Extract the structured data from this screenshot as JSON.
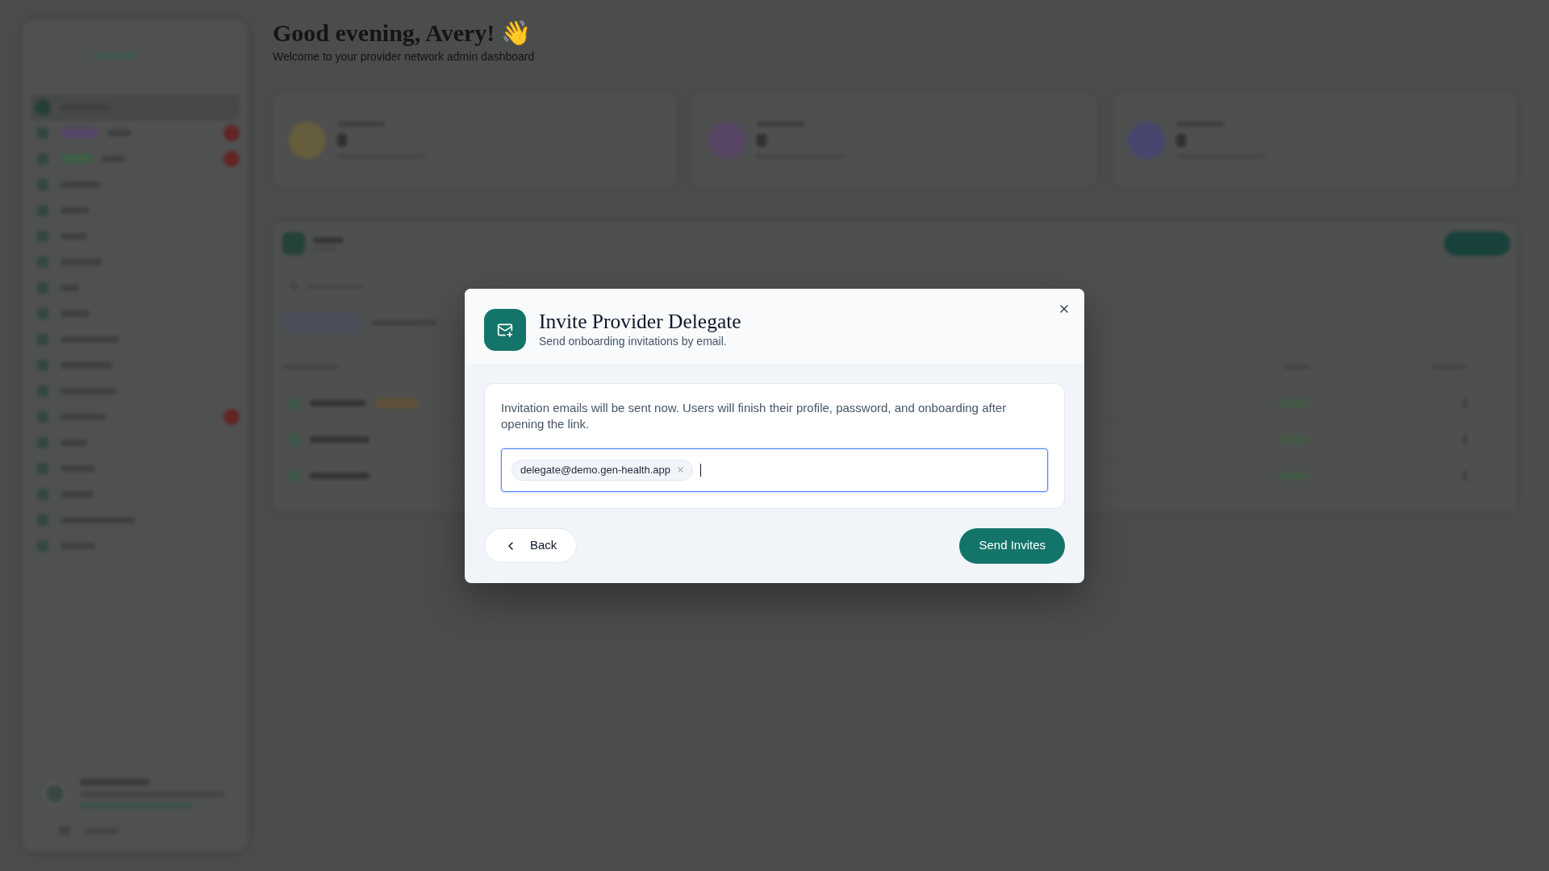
{
  "backdrop": {
    "greeting": "Good evening, Avery! 👋",
    "subtitle": "Welcome to your provider network admin dashboard"
  },
  "dialog": {
    "title": "Invite Provider Delegate",
    "subtitle": "Send onboarding invitations by email.",
    "description": "Invitation emails will be sent now. Users will finish their profile, password, and onboarding after opening the link.",
    "email_field": {
      "chips": [
        "delegate@demo.gen-health.app"
      ],
      "focused": true
    },
    "buttons": [
      {
        "label": "Back",
        "kind": "secondary"
      },
      {
        "label": "Send Invites",
        "kind": "primary"
      }
    ]
  }
}
